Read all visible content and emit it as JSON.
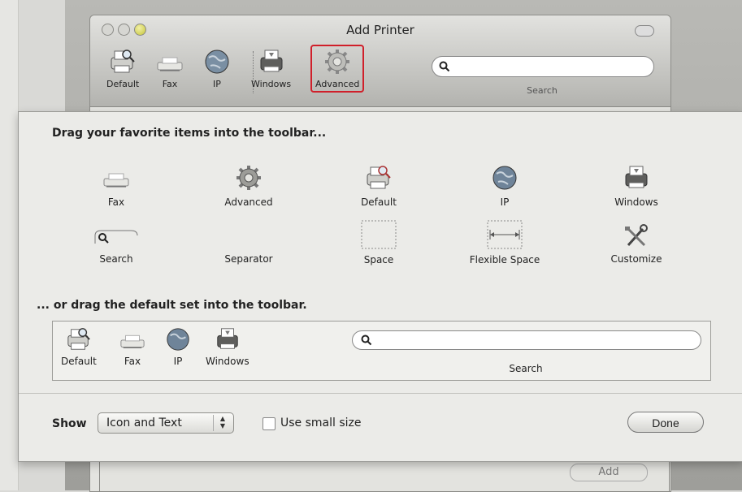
{
  "window": {
    "title": "Add Printer"
  },
  "toolbar": {
    "items": [
      {
        "label": "Default",
        "icon": "printer-magnifier-icon"
      },
      {
        "label": "Fax",
        "icon": "fax-icon"
      },
      {
        "label": "IP",
        "icon": "globe-icon"
      },
      {
        "label": "Windows",
        "icon": "windows-printer-icon"
      },
      {
        "label": "Advanced",
        "icon": "gear-icon"
      }
    ],
    "search_label": "Search",
    "highlight_color": "#d01f2a"
  },
  "customize_sheet": {
    "heading": "Drag your favorite items into the toolbar...",
    "items": [
      {
        "label": "Fax",
        "icon": "fax-icon"
      },
      {
        "label": "Advanced",
        "icon": "gear-icon"
      },
      {
        "label": "Default",
        "icon": "printer-magnifier-icon"
      },
      {
        "label": "IP",
        "icon": "globe-icon"
      },
      {
        "label": "Windows",
        "icon": "windows-printer-icon"
      },
      {
        "label": "Search",
        "icon": "search-field-icon"
      },
      {
        "label": "Separator",
        "icon": "separator-icon"
      },
      {
        "label": "Space",
        "icon": "space-icon"
      },
      {
        "label": "Flexible Space",
        "icon": "flexible-space-icon"
      },
      {
        "label": "Customize",
        "icon": "tools-icon"
      }
    ],
    "default_set_heading": "... or drag the default set into the toolbar.",
    "default_set": [
      {
        "label": "Default",
        "icon": "printer-magnifier-icon"
      },
      {
        "label": "Fax",
        "icon": "fax-icon"
      },
      {
        "label": "IP",
        "icon": "globe-icon"
      },
      {
        "label": "Windows",
        "icon": "windows-printer-icon"
      }
    ],
    "default_set_search_label": "Search",
    "show_label": "Show",
    "show_value": "Icon and Text",
    "small_size_label": "Use small size",
    "small_size_checked": false,
    "done_label": "Done"
  },
  "background_window": {
    "button_label": "Add"
  }
}
